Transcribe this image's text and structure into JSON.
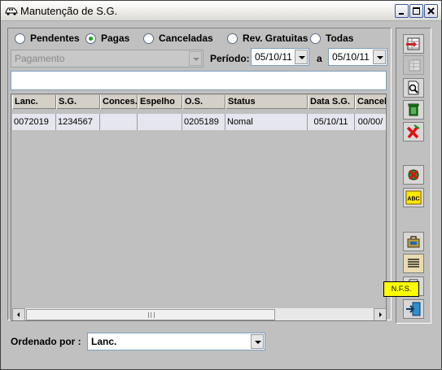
{
  "window": {
    "title": "Manutenção de S.G."
  },
  "filters": {
    "options": [
      {
        "label": "Pendentes",
        "checked": false
      },
      {
        "label": "Pagas",
        "checked": true
      },
      {
        "label": "Canceladas",
        "checked": false
      },
      {
        "label": "Rev. Gratuitas",
        "checked": false
      },
      {
        "label": "Todas",
        "checked": false
      }
    ],
    "accent_color": "#21a121"
  },
  "payment_type": {
    "value": "Pagamento",
    "disabled": true
  },
  "period": {
    "label": "Período:",
    "from": "05/10/11",
    "to_label": "a",
    "to": "05/10/11"
  },
  "search": {
    "value": ""
  },
  "table": {
    "columns": [
      "Lanc.",
      "S.G.",
      "Conces.",
      "Espelho",
      "O.S.",
      "Status",
      "Data S.G.",
      "Cancel"
    ],
    "rows": [
      [
        "0072019",
        "1234567",
        "",
        "",
        "0205189",
        "Nomal",
        "05/10/11",
        "00/00/"
      ]
    ]
  },
  "toolbar": {
    "buttons": [
      {
        "icon": "insert-row-icon"
      },
      {
        "icon": "edit-row-icon"
      },
      {
        "icon": "print-preview-icon"
      },
      {
        "icon": "trash-icon"
      },
      {
        "icon": "cancel-x-icon"
      },
      {
        "icon": "refresh-cancel-icon"
      },
      {
        "icon": "abc-spellcheck-icon"
      },
      {
        "icon": "bag-icon"
      },
      {
        "icon": "list-icon"
      },
      {
        "icon": "nfs-document-icon"
      },
      {
        "icon": "exit-door-icon"
      }
    ],
    "tooltip": "N.F.S."
  },
  "order": {
    "label": "Ordenado por :",
    "label_underline_char": "r",
    "value": "Lanc."
  }
}
